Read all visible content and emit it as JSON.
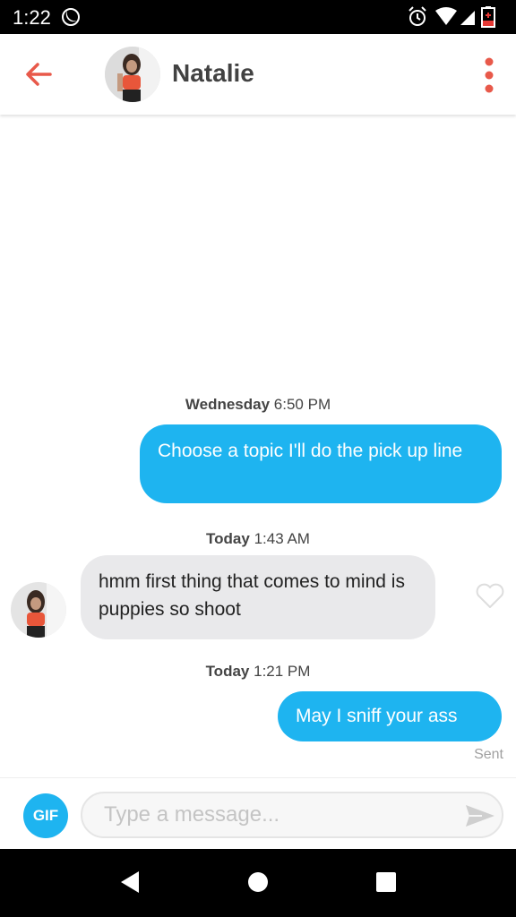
{
  "status_bar": {
    "time": "1:22"
  },
  "header": {
    "contact_name": "Natalie"
  },
  "messages": [
    {
      "type": "timestamp",
      "day": "Wednesday",
      "time": "6:50 PM"
    },
    {
      "type": "sent",
      "text": "Choose a topic I'll do the pick up line"
    },
    {
      "type": "timestamp",
      "day": "Today",
      "time": "1:43 AM"
    },
    {
      "type": "received",
      "text": "hmm first thing that comes to mind is puppies so shoot"
    },
    {
      "type": "timestamp",
      "day": "Today",
      "time": "1:21 PM"
    },
    {
      "type": "sent",
      "text": "May I sniff your ass",
      "status": "Sent"
    }
  ],
  "composer": {
    "gif_label": "GIF",
    "placeholder": "Type a message..."
  },
  "colors": {
    "accent": "#1EB4F0",
    "brand": "#E8594A"
  }
}
